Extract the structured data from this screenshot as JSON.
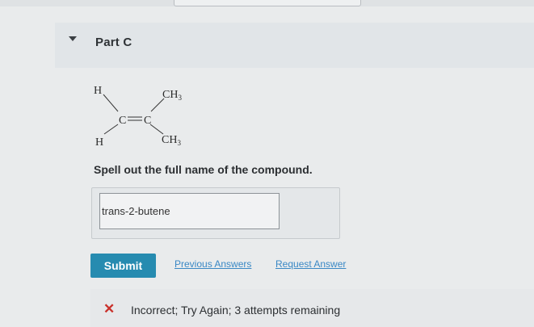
{
  "part": {
    "title": "Part C",
    "toggle_icon": "triangle-down-icon"
  },
  "molecule": {
    "top_left": "H",
    "bottom_left": "H",
    "top_right": "CH",
    "bottom_right": "CH",
    "subscript": "3",
    "center_left": "C",
    "center_right": "C"
  },
  "question": {
    "instruction": "Spell out the full name of the compound."
  },
  "answer": {
    "value": "trans-2-butene"
  },
  "actions": {
    "submit_label": "Submit",
    "previous_answers_label": "Previous Answers",
    "request_answer_label": "Request Answer"
  },
  "feedback": {
    "icon": "x-icon",
    "icon_glyph": "✕",
    "status": "Incorrect; Try Again; 3 attempts remaining",
    "icon_color": "#c9312b"
  },
  "colors": {
    "accent": "#268bb0",
    "link": "#3a88c5"
  }
}
